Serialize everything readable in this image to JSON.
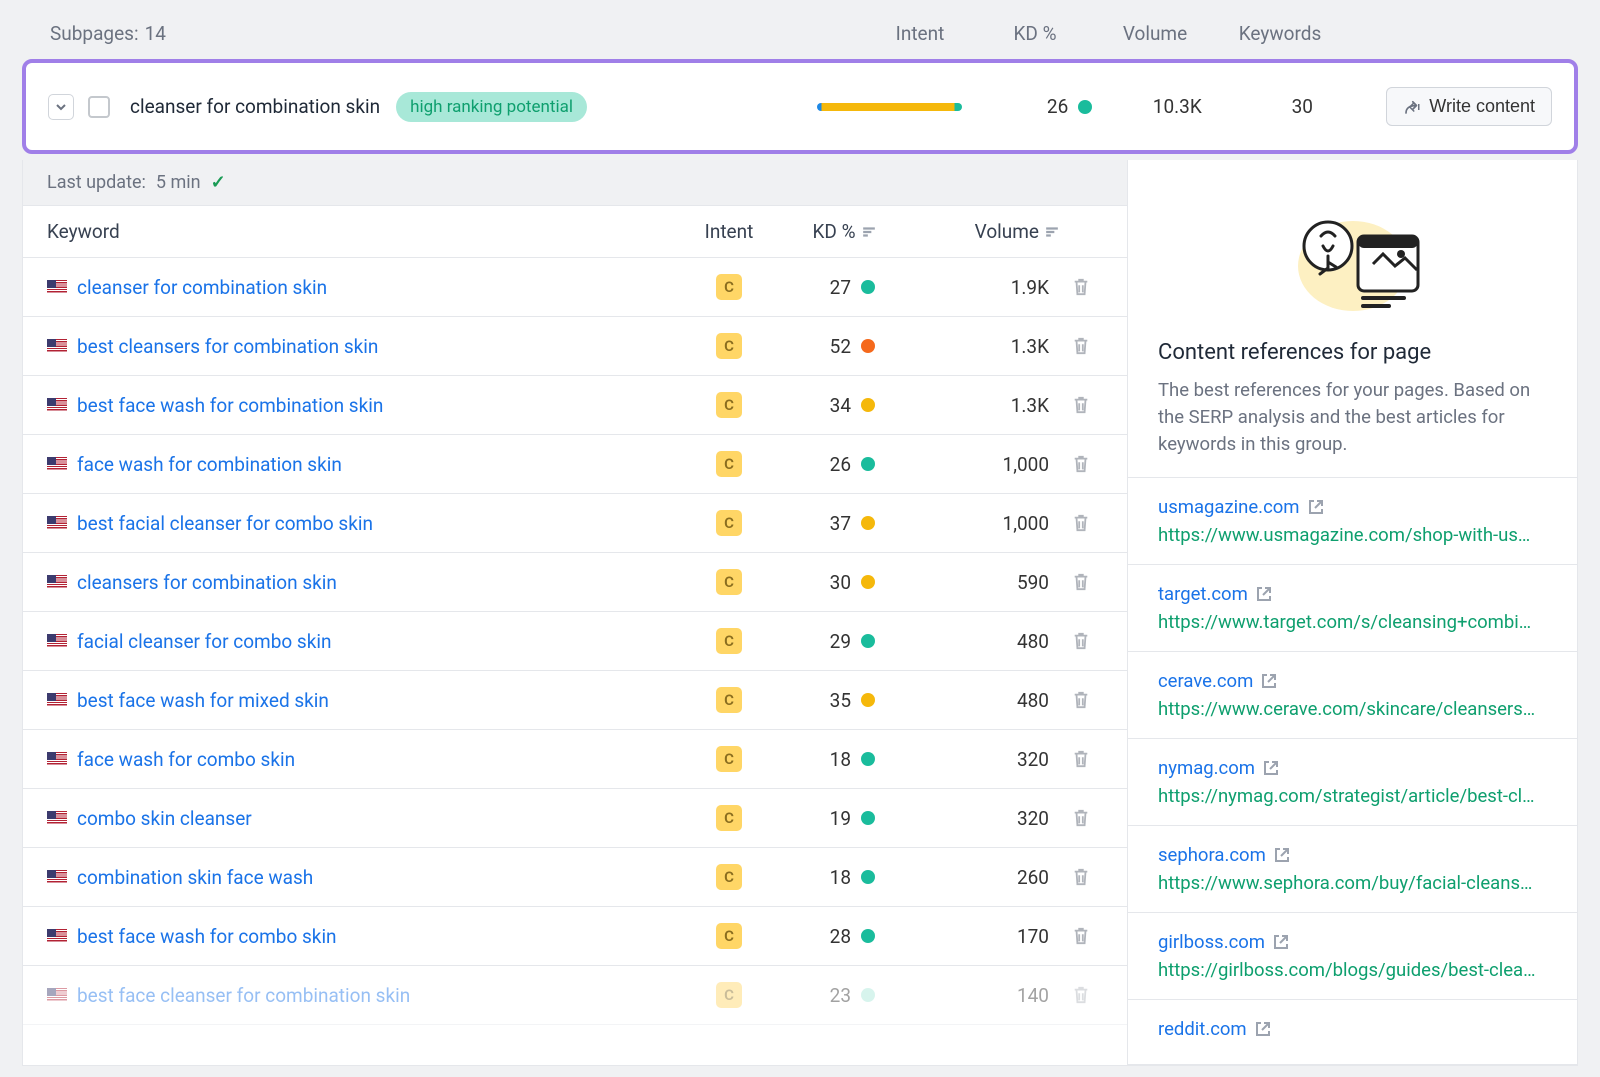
{
  "subpages": {
    "label": "Subpages:",
    "count": "14"
  },
  "top_headers": {
    "intent": "Intent",
    "kd": "KD %",
    "volume": "Volume",
    "keywords": "Keywords"
  },
  "group": {
    "title": "cleanser for combination skin",
    "badge": "high ranking potential",
    "kd": "26",
    "kd_color": "green",
    "volume": "10.3K",
    "keywords": "30",
    "write_label": "Write content"
  },
  "last_update": {
    "label": "Last update:",
    "value": "5 min"
  },
  "table_headers": {
    "keyword": "Keyword",
    "intent": "Intent",
    "kd": "KD %",
    "volume": "Volume"
  },
  "rows": [
    {
      "keyword": "cleanser for combination skin",
      "intent": "C",
      "kd": "27",
      "dot": "green",
      "volume": "1.9K"
    },
    {
      "keyword": "best cleansers for combination skin",
      "intent": "C",
      "kd": "52",
      "dot": "orange",
      "volume": "1.3K"
    },
    {
      "keyword": "best face wash for combination skin",
      "intent": "C",
      "kd": "34",
      "dot": "yellow",
      "volume": "1.3K"
    },
    {
      "keyword": "face wash for combination skin",
      "intent": "C",
      "kd": "26",
      "dot": "green",
      "volume": "1,000"
    },
    {
      "keyword": "best facial cleanser for combo skin",
      "intent": "C",
      "kd": "37",
      "dot": "yellow",
      "volume": "1,000"
    },
    {
      "keyword": "cleansers for combination skin",
      "intent": "C",
      "kd": "30",
      "dot": "yellow",
      "volume": "590"
    },
    {
      "keyword": "facial cleanser for combo skin",
      "intent": "C",
      "kd": "29",
      "dot": "green",
      "volume": "480"
    },
    {
      "keyword": "best face wash for mixed skin",
      "intent": "C",
      "kd": "35",
      "dot": "yellow",
      "volume": "480"
    },
    {
      "keyword": "face wash for combo skin",
      "intent": "C",
      "kd": "18",
      "dot": "green",
      "volume": "320"
    },
    {
      "keyword": "combo skin cleanser",
      "intent": "C",
      "kd": "19",
      "dot": "green",
      "volume": "320"
    },
    {
      "keyword": "combination skin face wash",
      "intent": "C",
      "kd": "18",
      "dot": "green",
      "volume": "260"
    },
    {
      "keyword": "best face wash for combo skin",
      "intent": "C",
      "kd": "28",
      "dot": "green",
      "volume": "170"
    },
    {
      "keyword": "best face cleanser for combination skin",
      "intent": "C",
      "kd": "23",
      "dot": "faded-green",
      "volume": "140",
      "faded": true
    }
  ],
  "refs": {
    "title": "Content references for page",
    "desc": "The best references for your pages. Based on the SERP analysis and the best articles for keywords in this group.",
    "items": [
      {
        "domain": "usmagazine.com",
        "url": "https://www.usmagazine.com/shop-with-us…"
      },
      {
        "domain": "target.com",
        "url": "https://www.target.com/s/cleansing+combi…"
      },
      {
        "domain": "cerave.com",
        "url": "https://www.cerave.com/skincare/cleansers…"
      },
      {
        "domain": "nymag.com",
        "url": "https://nymag.com/strategist/article/best-cl…"
      },
      {
        "domain": "sephora.com",
        "url": "https://www.sephora.com/buy/facial-cleans…"
      },
      {
        "domain": "girlboss.com",
        "url": "https://girlboss.com/blogs/guides/best-clea…"
      },
      {
        "domain": "reddit.com",
        "url": ""
      }
    ]
  }
}
